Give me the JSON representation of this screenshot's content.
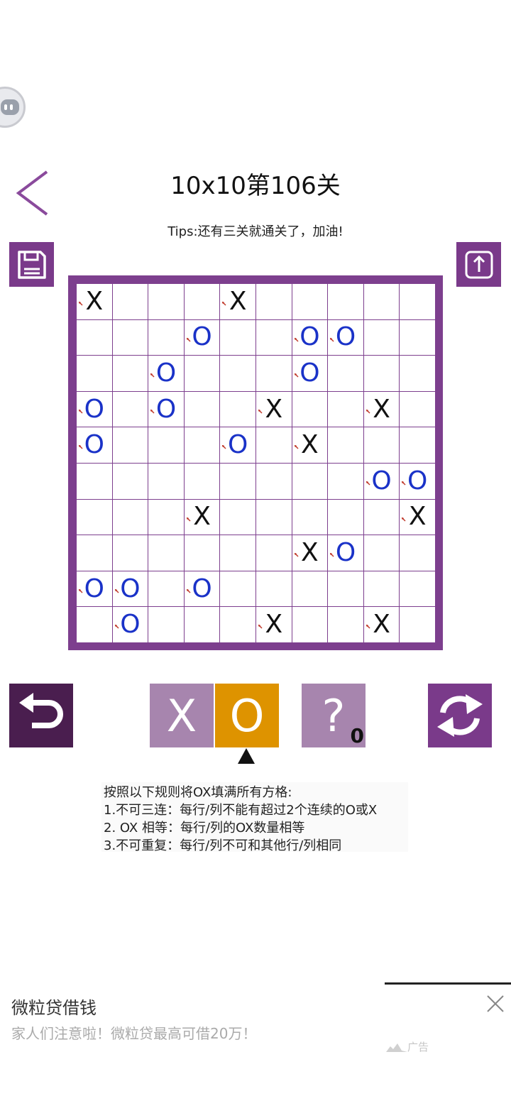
{
  "header": {
    "title": "10x10第106关",
    "tips": "Tips:还有三关就通关了，加油!"
  },
  "board": {
    "rows": [
      [
        "X",
        "",
        "",
        "",
        "X",
        "",
        "",
        "",
        "",
        ""
      ],
      [
        "",
        "",
        "",
        "O",
        "",
        "",
        "O",
        "O",
        "",
        ""
      ],
      [
        "",
        "",
        "O",
        "",
        "",
        "",
        "O",
        "",
        "",
        ""
      ],
      [
        "O",
        "",
        "O",
        "",
        "",
        "X",
        "",
        "",
        "X",
        ""
      ],
      [
        "O",
        "",
        "",
        "",
        "O",
        "",
        "X",
        "",
        "",
        ""
      ],
      [
        "",
        "",
        "",
        "",
        "",
        "",
        "",
        "",
        "O",
        "O"
      ],
      [
        "",
        "",
        "",
        "X",
        "",
        "",
        "",
        "",
        "",
        "X"
      ],
      [
        "",
        "",
        "",
        "",
        "",
        "",
        "X",
        "O",
        "",
        ""
      ],
      [
        "O",
        "O",
        "",
        "O",
        "",
        "",
        "",
        "",
        "",
        ""
      ],
      [
        "",
        "O",
        "",
        "",
        "",
        "X",
        "",
        "",
        "X",
        ""
      ]
    ],
    "fixed": [
      [
        true,
        false,
        false,
        false,
        true,
        false,
        false,
        false,
        false,
        false
      ],
      [
        false,
        false,
        false,
        true,
        false,
        false,
        true,
        true,
        false,
        false
      ],
      [
        false,
        false,
        true,
        false,
        false,
        false,
        true,
        false,
        false,
        false
      ],
      [
        true,
        false,
        true,
        false,
        false,
        true,
        false,
        false,
        true,
        false
      ],
      [
        true,
        false,
        false,
        false,
        true,
        false,
        true,
        false,
        false,
        false
      ],
      [
        false,
        false,
        false,
        false,
        false,
        false,
        false,
        false,
        true,
        true
      ],
      [
        false,
        false,
        false,
        true,
        false,
        false,
        false,
        false,
        false,
        true
      ],
      [
        false,
        false,
        false,
        false,
        false,
        false,
        true,
        true,
        false,
        false
      ],
      [
        true,
        true,
        false,
        true,
        false,
        false,
        false,
        false,
        false,
        false
      ],
      [
        false,
        true,
        false,
        false,
        false,
        true,
        false,
        false,
        true,
        false
      ]
    ]
  },
  "picker": {
    "x_label": "X",
    "o_label": "O",
    "help_label": "?",
    "help_count": "0",
    "selected": "O"
  },
  "rules": [
    "按照以下规则将OX填满所有方格:",
    "1.不可三连：每行/列不能有超过2个连续的O或X",
    "2. OX 相等：每行/列的OX数量相等",
    "3.不可重复：每行/列不可和其他行/列相同"
  ],
  "ad": {
    "title": "微粒贷借钱",
    "subtitle": "家人们注意啦！微粒贷最高可借20万！",
    "tag": "广告"
  },
  "colors": {
    "accent": "#7d3f8e",
    "o_mark": "#1a32c8",
    "selected": "#de9300"
  }
}
